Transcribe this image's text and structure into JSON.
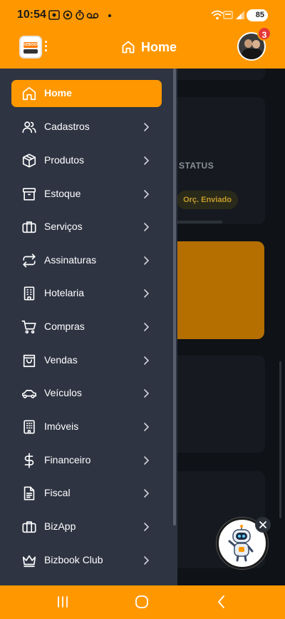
{
  "status_bar": {
    "time": "10:54",
    "battery": "85"
  },
  "header": {
    "logo_text": "BIZBOOK",
    "title": "Home",
    "notification_count": "3"
  },
  "background_page": {
    "status_label": "STATUS",
    "status_badge": "Orç. Enviado"
  },
  "menu": {
    "items": [
      {
        "label": "Home",
        "icon": "home-icon",
        "active": true
      },
      {
        "label": "Cadastros",
        "icon": "users-icon"
      },
      {
        "label": "Produtos",
        "icon": "box-icon"
      },
      {
        "label": "Estoque",
        "icon": "archive-icon"
      },
      {
        "label": "Serviços",
        "icon": "briefcase-icon"
      },
      {
        "label": "Assinaturas",
        "icon": "repeat-icon"
      },
      {
        "label": "Hotelaria",
        "icon": "building-icon"
      },
      {
        "label": "Compras",
        "icon": "cart-icon"
      },
      {
        "label": "Vendas",
        "icon": "shopping-bag-icon"
      },
      {
        "label": "Veículos",
        "icon": "car-icon"
      },
      {
        "label": "Imóveis",
        "icon": "apartment-icon"
      },
      {
        "label": "Financeiro",
        "icon": "dollar-icon"
      },
      {
        "label": "Fiscal",
        "icon": "document-icon"
      },
      {
        "label": "BizApp",
        "icon": "briefcase-icon"
      },
      {
        "label": "Bizbook Club",
        "icon": "crown-icon"
      }
    ]
  },
  "colors": {
    "accent": "#ff9800",
    "drawer_bg": "#2e3442",
    "page_bg": "#0f1216",
    "badge_red": "#e53935"
  }
}
